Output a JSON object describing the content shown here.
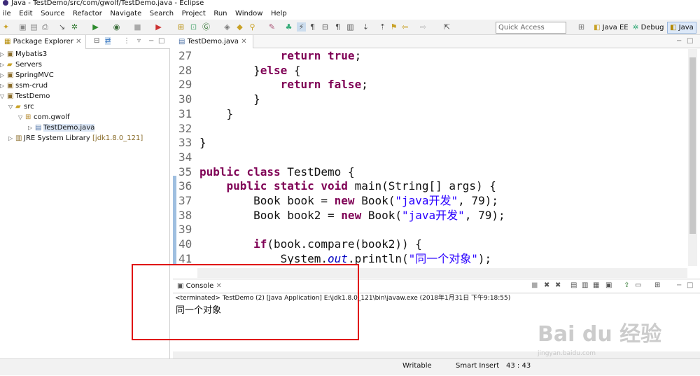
{
  "window": {
    "title": "Java - TestDemo/src/com/gwolf/TestDemo.java - Eclipse"
  },
  "menu": [
    "ile",
    "Edit",
    "Source",
    "Refactor",
    "Navigate",
    "Search",
    "Project",
    "Run",
    "Window",
    "Help"
  ],
  "quick_access": {
    "placeholder": "Quick Access"
  },
  "perspectives": [
    "Java EE",
    "Debug",
    "Java"
  ],
  "package_explorer": {
    "title": "Package Explorer",
    "items": [
      {
        "label": "Mybatis3",
        "icon": "project-icon",
        "expanded": false,
        "selected": false
      },
      {
        "label": "Servers",
        "icon": "folder-icon",
        "expanded": false,
        "selected": false
      },
      {
        "label": "SpringMVC",
        "icon": "project-icon",
        "expanded": false,
        "selected": false
      },
      {
        "label": "ssm-crud",
        "icon": "project-icon",
        "expanded": false,
        "selected": false
      },
      {
        "label": "TestDemo",
        "icon": "project-icon",
        "expanded": true,
        "selected": false
      },
      {
        "label": "src",
        "icon": "source-folder-icon",
        "expanded": true,
        "selected": false
      },
      {
        "label": "com.gwolf",
        "icon": "package-icon",
        "expanded": true,
        "selected": false
      },
      {
        "label": "TestDemo.java",
        "icon": "java-file-icon",
        "expanded": false,
        "selected": true
      },
      {
        "label": "JRE System Library",
        "suffix": "[jdk1.8.0_121]",
        "icon": "library-icon",
        "expanded": false,
        "selected": false
      }
    ]
  },
  "editor": {
    "tab": "TestDemo.java",
    "lines": [
      {
        "n": "27",
        "segs": [
          {
            "t": "            "
          },
          {
            "t": "return",
            "c": "kw"
          },
          {
            "t": " "
          },
          {
            "t": "true",
            "c": "kw"
          },
          {
            "t": ";"
          }
        ]
      },
      {
        "n": "28",
        "segs": [
          {
            "t": "        }"
          },
          {
            "t": "else",
            "c": "kw"
          },
          {
            "t": " {"
          }
        ]
      },
      {
        "n": "29",
        "segs": [
          {
            "t": "            "
          },
          {
            "t": "return",
            "c": "kw"
          },
          {
            "t": " "
          },
          {
            "t": "false",
            "c": "kw"
          },
          {
            "t": ";"
          }
        ]
      },
      {
        "n": "30",
        "segs": [
          {
            "t": "        }"
          }
        ]
      },
      {
        "n": "31",
        "segs": [
          {
            "t": "    }"
          }
        ]
      },
      {
        "n": "32",
        "segs": [
          {
            "t": ""
          }
        ]
      },
      {
        "n": "33",
        "segs": [
          {
            "t": "}"
          }
        ]
      },
      {
        "n": "34",
        "segs": [
          {
            "t": ""
          }
        ]
      },
      {
        "n": "35",
        "segs": [
          {
            "t": "public",
            "c": "kw"
          },
          {
            "t": " "
          },
          {
            "t": "class",
            "c": "kw"
          },
          {
            "t": " TestDemo {"
          }
        ]
      },
      {
        "n": "36",
        "segs": [
          {
            "t": "    "
          },
          {
            "t": "public",
            "c": "kw"
          },
          {
            "t": " "
          },
          {
            "t": "static",
            "c": "kw"
          },
          {
            "t": " "
          },
          {
            "t": "void",
            "c": "kw"
          },
          {
            "t": " main(String[] args) {"
          }
        ]
      },
      {
        "n": "37",
        "segs": [
          {
            "t": "        Book book = "
          },
          {
            "t": "new",
            "c": "kw"
          },
          {
            "t": " Book("
          },
          {
            "t": "\"java开发\"",
            "c": "str"
          },
          {
            "t": ", 79);"
          }
        ]
      },
      {
        "n": "38",
        "segs": [
          {
            "t": "        Book book2 = "
          },
          {
            "t": "new",
            "c": "kw"
          },
          {
            "t": " Book("
          },
          {
            "t": "\"java开发\"",
            "c": "str"
          },
          {
            "t": ", 79);"
          }
        ]
      },
      {
        "n": "39",
        "segs": [
          {
            "t": ""
          }
        ]
      },
      {
        "n": "40",
        "segs": [
          {
            "t": "        "
          },
          {
            "t": "if",
            "c": "kw"
          },
          {
            "t": "(book.compare(book2)) {"
          }
        ]
      },
      {
        "n": "41",
        "segs": [
          {
            "t": "            System."
          },
          {
            "t": "out",
            "c": "ital"
          },
          {
            "t": ".println("
          },
          {
            "t": "\"同一个对象\"",
            "c": "str"
          },
          {
            "t": ");"
          }
        ]
      }
    ]
  },
  "console": {
    "title": "Console",
    "info": "<terminated> TestDemo (2) [Java Application] E:\\jdk1.8.0_121\\bin\\javaw.exe (2018年1月31日 下午9:18:55)",
    "output": "同一个对象"
  },
  "status": {
    "mode": "Writable",
    "insert": "Smart Insert",
    "position": "43 : 43"
  },
  "watermark": {
    "main": "Bai du 经验",
    "sub": "jingyan.baidu.com"
  },
  "colors": {
    "keyword": "#7f0055",
    "string": "#2a00ff",
    "highlight_box": "#e01010"
  }
}
